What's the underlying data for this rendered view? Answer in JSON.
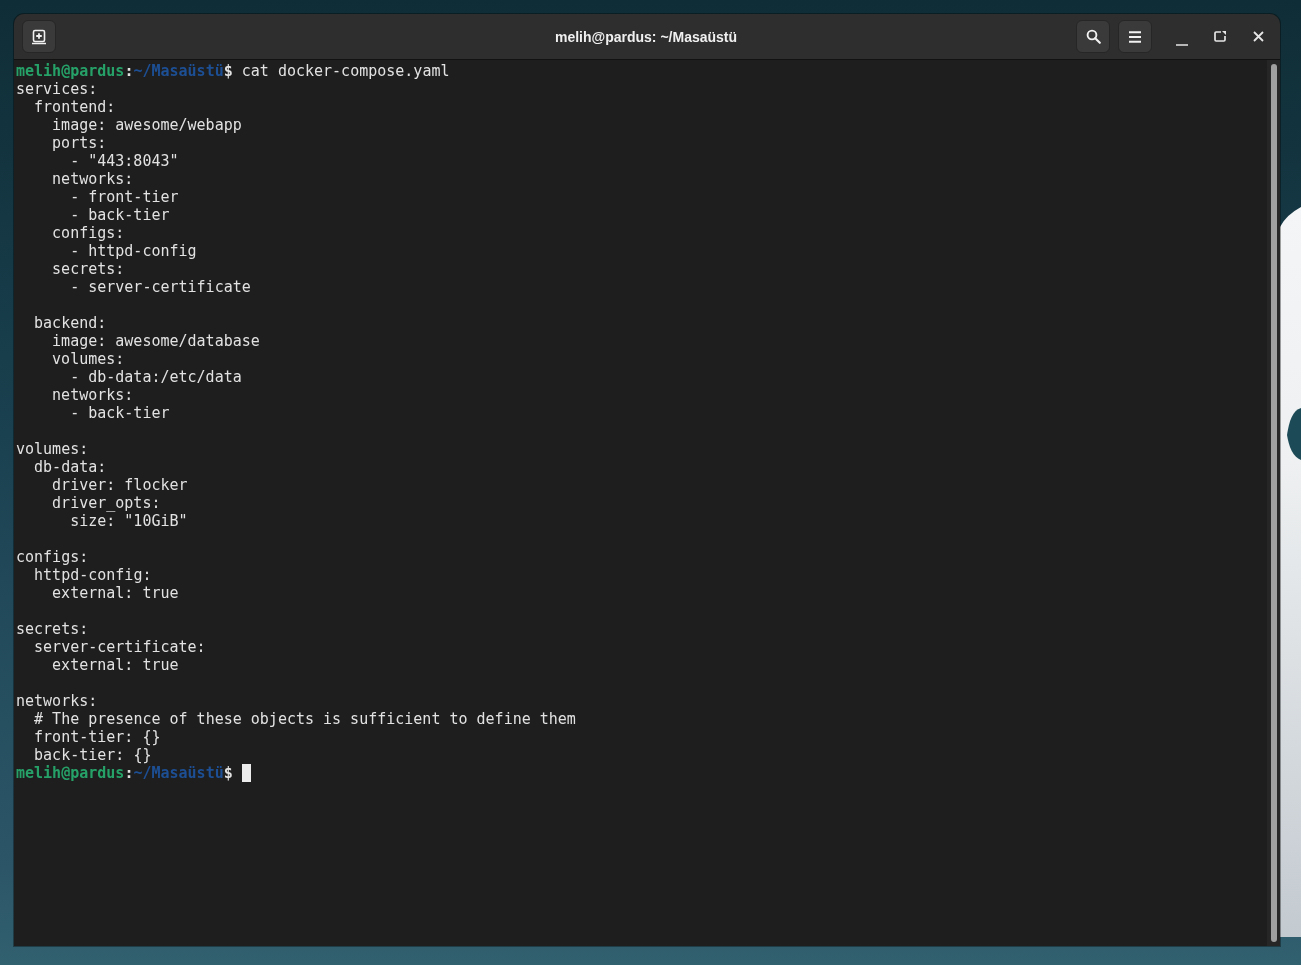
{
  "window": {
    "title": "melih@pardus: ~/Masaüstü"
  },
  "terminal": {
    "entries": [
      {
        "kind": "prompt",
        "user_host": "melih@pardus",
        "separator": ":",
        "path": "~/Masaüstü",
        "symbol": "$",
        "command": "cat docker-compose.yaml",
        "cursor": false
      },
      {
        "kind": "output",
        "lines": [
          {
            "text": "services:",
            "children": [
              {
                "text": "frontend:",
                "children": [
                  {
                    "text": "image: awesome/webapp"
                  },
                  {
                    "text": "ports:",
                    "children": [
                      {
                        "text": "- \"443:8043\""
                      }
                    ]
                  },
                  {
                    "text": "networks:",
                    "children": [
                      {
                        "text": "- front-tier"
                      },
                      {
                        "text": "- back-tier"
                      }
                    ]
                  },
                  {
                    "text": "configs:",
                    "children": [
                      {
                        "text": "- httpd-config"
                      }
                    ]
                  },
                  {
                    "text": "secrets:",
                    "children": [
                      {
                        "text": "- server-certificate"
                      }
                    ]
                  }
                ]
              },
              {
                "text": "backend:",
                "blank_line_before": true,
                "children": [
                  {
                    "text": "image: awesome/database"
                  },
                  {
                    "text": "volumes:",
                    "children": [
                      {
                        "text": "- db-data:/etc/data"
                      }
                    ]
                  },
                  {
                    "text": "networks:",
                    "children": [
                      {
                        "text": "- back-tier"
                      }
                    ]
                  }
                ]
              }
            ]
          },
          {
            "text": "volumes:",
            "blank_line_before": true,
            "children": [
              {
                "text": "db-data:",
                "children": [
                  {
                    "text": "driver: flocker"
                  },
                  {
                    "text": "driver_opts:",
                    "children": [
                      {
                        "text": "size: \"10GiB\""
                      }
                    ]
                  }
                ]
              }
            ]
          },
          {
            "text": "configs:",
            "blank_line_before": true,
            "children": [
              {
                "text": "httpd-config:",
                "children": [
                  {
                    "text": "external: true"
                  }
                ]
              }
            ]
          },
          {
            "text": "secrets:",
            "blank_line_before": true,
            "children": [
              {
                "text": "server-certificate:",
                "children": [
                  {
                    "text": "external: true"
                  }
                ]
              }
            ]
          },
          {
            "text": "networks:",
            "blank_line_before": true,
            "children": [
              {
                "text": "# The presence of these objects is sufficient to define them"
              },
              {
                "text": "front-tier: {}"
              },
              {
                "text": "back-tier: {}"
              }
            ]
          }
        ]
      },
      {
        "kind": "prompt",
        "user_host": "melih@pardus",
        "separator": ":",
        "path": "~/Masaüstü",
        "symbol": "$",
        "cursor": true
      }
    ]
  }
}
